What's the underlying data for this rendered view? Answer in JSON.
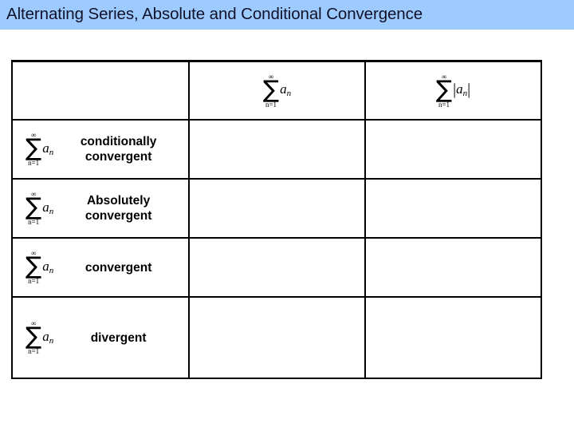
{
  "slide": {
    "title": "Alternating Series, Absolute and Conditional Convergence",
    "banner_color": "#9ecbff",
    "title_color": "#11112a",
    "background_color": "#ffffff",
    "border_color": "#000000"
  },
  "table": {
    "columns": [
      {
        "id": "col-corner",
        "header_type": "empty",
        "header_text": ""
      },
      {
        "id": "col-sum-an",
        "header_type": "formula",
        "formula": {
          "operator": "∑",
          "upper_limit": "∞",
          "lower_limit": "n=1",
          "term": "a",
          "term_subscript": "n",
          "absolute_value": false
        }
      },
      {
        "id": "col-sum-abs-an",
        "header_type": "formula",
        "formula": {
          "operator": "∑",
          "upper_limit": "∞",
          "lower_limit": "n=1",
          "term": "a",
          "term_subscript": "n",
          "absolute_value": true,
          "bar_left": "|",
          "bar_right": "|"
        }
      }
    ],
    "rows": [
      {
        "id": "row-conditionally-convergent",
        "row_header": {
          "formula": {
            "operator": "∑",
            "upper_limit": "∞",
            "lower_limit": "n=1",
            "term": "a",
            "term_subscript": "n"
          },
          "label_lines": [
            "conditionally",
            "convergent"
          ]
        },
        "cells": [
          "",
          ""
        ]
      },
      {
        "id": "row-absolutely-convergent",
        "row_header": {
          "formula": {
            "operator": "∑",
            "upper_limit": "∞",
            "lower_limit": "n=1",
            "term": "a",
            "term_subscript": "n"
          },
          "label_lines": [
            "Absolutely",
            "convergent"
          ]
        },
        "cells": [
          "",
          ""
        ]
      },
      {
        "id": "row-convergent",
        "row_header": {
          "formula": {
            "operator": "∑",
            "upper_limit": "∞",
            "lower_limit": "n=1",
            "term": "a",
            "term_subscript": "n"
          },
          "label_lines": [
            "convergent"
          ]
        },
        "cells": [
          "",
          ""
        ]
      },
      {
        "id": "row-divergent",
        "row_header": {
          "formula": {
            "operator": "∑",
            "upper_limit": "∞",
            "lower_limit": "n=1",
            "term": "a",
            "term_subscript": "n"
          },
          "label_lines": [
            "divergent"
          ]
        },
        "cells": [
          "",
          ""
        ]
      }
    ]
  }
}
